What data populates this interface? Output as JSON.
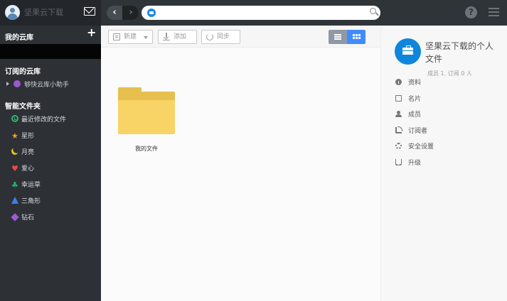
{
  "header": {
    "username": "坚果云下载",
    "nav_back": "‹",
    "nav_forward": "›",
    "search_placeholder": "",
    "help_label": "?"
  },
  "sidebar": {
    "my_libraries": "我的云库",
    "add": "+",
    "subscribed_libraries": "订阅的云库",
    "assistant": "够快云库小助手",
    "smart_folders": "智能文件夹",
    "smart_items": [
      {
        "name": "clock-icon",
        "label": "最近修改的文件"
      },
      {
        "name": "star-icon",
        "label": "星形"
      },
      {
        "name": "moon-icon",
        "label": "月亮"
      },
      {
        "name": "heart-icon",
        "label": "爱心"
      },
      {
        "name": "clover-icon",
        "label": "幸运草"
      },
      {
        "name": "triangle-icon",
        "label": "三角形"
      },
      {
        "name": "diamond-icon",
        "label": "钻石"
      }
    ]
  },
  "toolbar": {
    "new_label": "新建",
    "add_label": "添加",
    "sync_label": "同步"
  },
  "content": {
    "folder_name": "我的文件"
  },
  "details": {
    "library_title": "坚果云下载的个人文件",
    "meta": "成员 1, 订阅 0 人",
    "menu": [
      {
        "icon": "info-icon",
        "label": "资料"
      },
      {
        "icon": "card-icon",
        "label": "名片"
      },
      {
        "icon": "members-icon",
        "label": "成员"
      },
      {
        "icon": "rss-icon",
        "label": "订阅者"
      },
      {
        "icon": "gear-icon",
        "label": "安全设置"
      },
      {
        "icon": "cart-icon",
        "label": "升级"
      }
    ]
  },
  "colors": {
    "topbar": "#2f3439",
    "sidebar": "#2d3135",
    "accent": "#3f8cff",
    "folder": "#f8d466"
  }
}
